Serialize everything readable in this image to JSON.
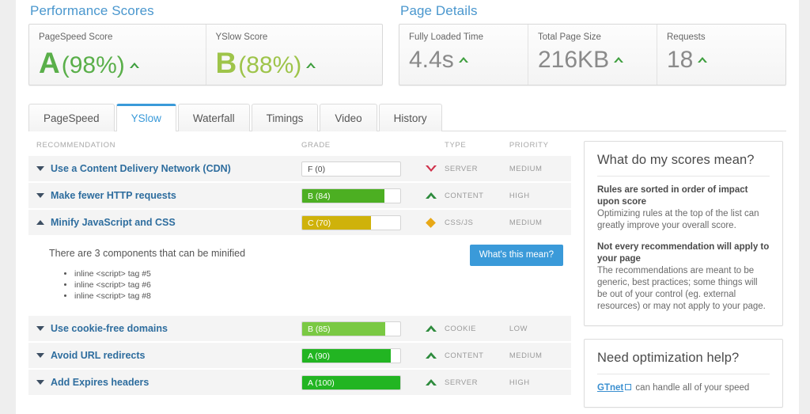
{
  "performance": {
    "section_title": "Performance Scores",
    "metrics": [
      {
        "label": "PageSpeed Score",
        "grade": "A",
        "percent": "(98%)",
        "trend": "caret-up-icon",
        "color": "#5aaf4a"
      },
      {
        "label": "YSlow Score",
        "grade": "B",
        "percent": "(88%)",
        "trend": "caret-up-icon",
        "color": "#9ec44a"
      }
    ]
  },
  "page_details": {
    "section_title": "Page Details",
    "metrics": [
      {
        "label": "Fully Loaded Time",
        "value": "4.4s",
        "trend": "caret-up-icon"
      },
      {
        "label": "Total Page Size",
        "value": "216KB",
        "trend": "caret-up-icon"
      },
      {
        "label": "Requests",
        "value": "18",
        "trend": "caret-up-icon"
      }
    ]
  },
  "tabs": [
    {
      "label": "PageSpeed",
      "active": false
    },
    {
      "label": "YSlow",
      "active": true
    },
    {
      "label": "Waterfall",
      "active": false
    },
    {
      "label": "Timings",
      "active": false
    },
    {
      "label": "Video",
      "active": false
    },
    {
      "label": "History",
      "active": false
    }
  ],
  "table": {
    "headers": {
      "recommendation": "RECOMMENDATION",
      "grade": "GRADE",
      "type": "TYPE",
      "priority": "PRIORITY"
    },
    "rows": [
      {
        "name": "Use a Content Delivery Network (CDN)",
        "expanded": false,
        "grade_label": "F (0)",
        "grade_value": 0,
        "bar_color": "#ffffff",
        "icon": "chevron-down-red-icon",
        "type": "SERVER",
        "priority": "MEDIUM"
      },
      {
        "name": "Make fewer HTTP requests",
        "expanded": false,
        "grade_label": "B (84)",
        "grade_value": 84,
        "bar_color": "#4caf22",
        "icon": "chevron-up-green-icon",
        "type": "CONTENT",
        "priority": "HIGH"
      },
      {
        "name": "Minify JavaScript and CSS",
        "expanded": true,
        "grade_label": "C (70)",
        "grade_value": 70,
        "bar_color": "#cfb20a",
        "icon": "diamond-orange-icon",
        "type": "CSS/JS",
        "priority": "MEDIUM"
      },
      {
        "name": "Use cookie-free domains",
        "expanded": false,
        "grade_label": "B (85)",
        "grade_value": 85,
        "bar_color": "#7ac943",
        "icon": "chevron-up-green-icon",
        "type": "COOKIE",
        "priority": "LOW"
      },
      {
        "name": "Avoid URL redirects",
        "expanded": false,
        "grade_label": "A (90)",
        "grade_value": 90,
        "bar_color": "#22b522",
        "icon": "chevron-up-green-icon",
        "type": "CONTENT",
        "priority": "MEDIUM"
      },
      {
        "name": "Add Expires headers",
        "expanded": false,
        "grade_label": "A (100)",
        "grade_value": 100,
        "bar_color": "#22b522",
        "icon": "chevron-up-green-icon",
        "type": "SERVER",
        "priority": "HIGH"
      }
    ],
    "detail": {
      "summary": "There are 3 components that can be minified",
      "items": [
        "inline <script> tag #5",
        "inline <script> tag #6",
        "inline <script> tag #8"
      ],
      "button_label": "What's this mean?"
    }
  },
  "sidebar": {
    "scores_panel": {
      "title": "What do my scores mean?",
      "blocks": [
        {
          "heading": "Rules are sorted in order of impact upon score",
          "body": "Optimizing rules at the top of the list can greatly improve your overall score."
        },
        {
          "heading": "Not every recommendation will apply to your page",
          "body": "The recommendations are meant to be generic, best practices; some things will be out of your control (eg. external resources) or may not apply to your page."
        }
      ]
    },
    "help_panel": {
      "title": "Need optimization help?",
      "link_label": "GTnet",
      "link_icon": "external-link-icon",
      "body": " can handle all of your speed"
    }
  },
  "colors": {
    "accent_blue": "#3a9ad9",
    "heading_blue": "#4a97ce",
    "link_blue": "#2e6d9e"
  }
}
